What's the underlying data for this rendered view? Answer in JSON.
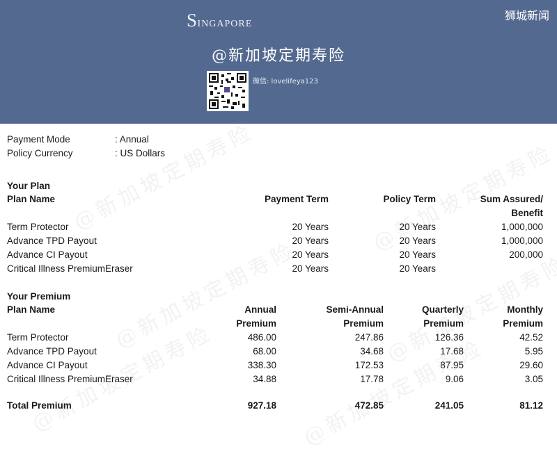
{
  "header": {
    "logo_initial": "S",
    "logo_rest": "ingapore",
    "corner_label": "狮城新闻",
    "title": "@新加坡定期寿险",
    "wechat": "微信: lovelifeya123",
    "watermark_text": "@新加坡定期寿险"
  },
  "policy": {
    "payment_mode_label": "Payment Mode",
    "payment_mode_value": ": Annual",
    "currency_label": "Policy Currency",
    "currency_value": ": US Dollars"
  },
  "plan": {
    "section_title": "Your Plan",
    "headers": {
      "plan_name": "Plan Name",
      "payment_term": "Payment Term",
      "policy_term": "Policy Term",
      "sum_assured_1": "Sum Assured/",
      "sum_assured_2": "Benefit"
    },
    "rows": [
      {
        "name": "Term Protector",
        "payment_term": "20 Years",
        "policy_term": "20 Years",
        "sum_assured": "1,000,000"
      },
      {
        "name": "Advance TPD Payout",
        "payment_term": "20 Years",
        "policy_term": "20 Years",
        "sum_assured": "1,000,000"
      },
      {
        "name": "Advance CI Payout",
        "payment_term": "20 Years",
        "policy_term": "20 Years",
        "sum_assured": "200,000"
      },
      {
        "name": "Critical Illness PremiumEraser",
        "payment_term": "20 Years",
        "policy_term": "20 Years",
        "sum_assured": ""
      }
    ]
  },
  "premium": {
    "section_title": "Your Premium",
    "headers": {
      "plan_name": "Plan Name",
      "annual_1": "Annual",
      "annual_2": "Premium",
      "semi_1": "Semi-Annual",
      "semi_2": "Premium",
      "quarterly_1": "Quarterly",
      "quarterly_2": "Premium",
      "monthly_1": "Monthly",
      "monthly_2": "Premium"
    },
    "rows": [
      {
        "name": "Term Protector",
        "annual": "486.00",
        "semi": "247.86",
        "quarterly": "126.36",
        "monthly": "42.52"
      },
      {
        "name": "Advance TPD Payout",
        "annual": "68.00",
        "semi": "34.68",
        "quarterly": "17.68",
        "monthly": "5.95"
      },
      {
        "name": "Advance CI Payout",
        "annual": "338.30",
        "semi": "172.53",
        "quarterly": "87.95",
        "monthly": "29.60"
      },
      {
        "name": "Critical Illness PremiumEraser",
        "annual": "34.88",
        "semi": "17.78",
        "quarterly": "9.06",
        "monthly": "3.05"
      }
    ],
    "total": {
      "label": "Total Premium",
      "annual": "927.18",
      "semi": "472.85",
      "quarterly": "241.05",
      "monthly": "81.12"
    }
  }
}
